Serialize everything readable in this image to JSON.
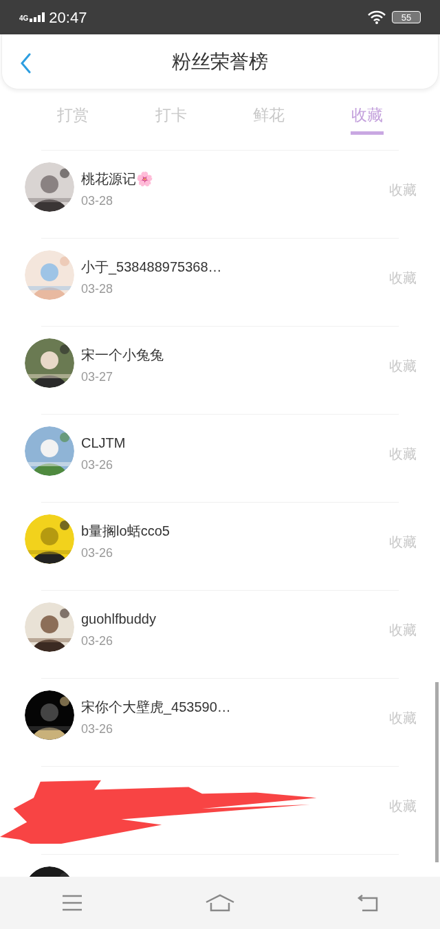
{
  "status_bar": {
    "network": "4G",
    "time": "20:47",
    "battery": "55"
  },
  "header": {
    "title": "粉丝荣誉榜"
  },
  "tabs": [
    {
      "label": "打赏",
      "selected": false
    },
    {
      "label": "打卡",
      "selected": false
    },
    {
      "label": "鲜花",
      "selected": false
    },
    {
      "label": "收藏",
      "selected": true
    }
  ],
  "rows": [
    {
      "kind": "fan",
      "name": "桃花源记🌸",
      "date": "03-28",
      "action": "收藏"
    },
    {
      "kind": "fan",
      "name": "小于_538488975368…",
      "date": "03-28",
      "action": "收藏"
    },
    {
      "kind": "fan",
      "name": "宋一个小兔兔",
      "date": "03-27",
      "action": "收藏"
    },
    {
      "kind": "fan",
      "name": "CLJTM",
      "date": "03-26",
      "action": "收藏"
    },
    {
      "kind": "fan",
      "name": "b量搁lo蛞cco5",
      "date": "03-26",
      "action": "收藏"
    },
    {
      "kind": "fan",
      "name": "guohlfbuddy",
      "date": "03-26",
      "action": "收藏"
    },
    {
      "kind": "fan",
      "name": "宋你个大壁虎_453590…",
      "date": "03-26",
      "action": "收藏"
    },
    {
      "kind": "redacted",
      "action": "收藏"
    },
    {
      "kind": "cut"
    }
  ]
}
